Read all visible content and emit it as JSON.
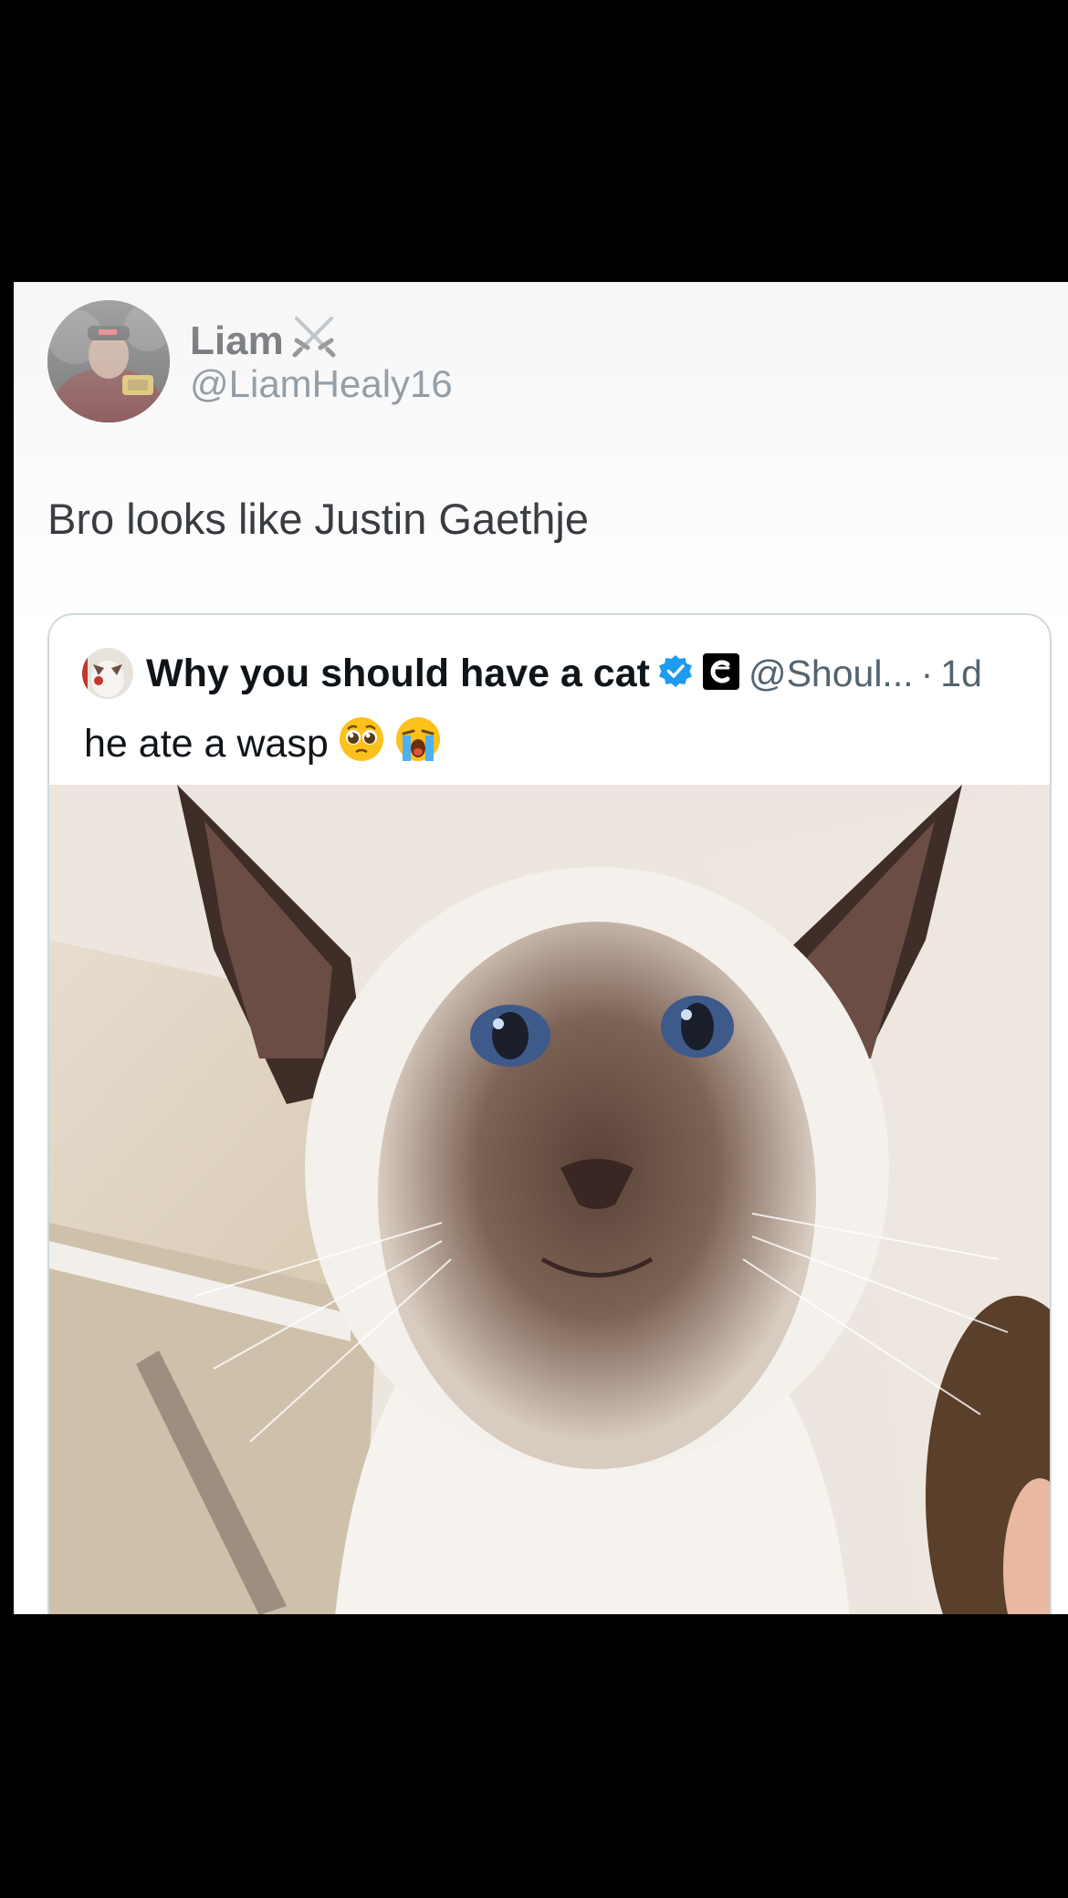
{
  "tweet": {
    "display_name": "Liam",
    "name_emoji": "crossed-swords-icon",
    "handle": "@LiamHealy16",
    "text": "Bro looks like Justin Gaethje"
  },
  "quote": {
    "display_name": "Why you should have a cat",
    "verified": "verified-badge-icon",
    "affiliate": "affiliate-badge-icon",
    "handle": "@Shoul...",
    "separator": "·",
    "time": "1d",
    "text": "he ate a wasp",
    "emojis": [
      "pleading-face-icon",
      "loudly-crying-face-icon"
    ]
  },
  "colors": {
    "text_primary": "#0f1419",
    "text_secondary": "#536471",
    "verified_blue": "#1d9bf0",
    "border": "#cfd9de",
    "background": "#000000"
  }
}
